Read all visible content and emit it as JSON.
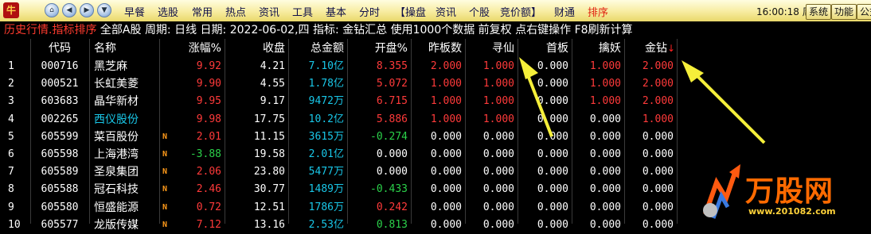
{
  "toolbar": {
    "logo": "牛",
    "menu": [
      "早餐",
      "选股",
      "常用",
      "热点",
      "资讯",
      "工具",
      "基本",
      "分时",
      "【操盘",
      "资讯",
      "个股",
      "竞价额】",
      "财通",
      "排序"
    ],
    "active_index": 13,
    "clock": "16:00:18 周一",
    "buttons": [
      "系统",
      "功能",
      "公式"
    ]
  },
  "info": {
    "title": "历史行情.指标排序",
    "scope": "全部A股",
    "params": "周期: 日线  日期: 2022-06-02,四  指标: 金钻汇总  使用1000个数据 前复权 点右键操作 F8刷新计算"
  },
  "table": {
    "headers": [
      "",
      "代码",
      "名称",
      "",
      "涨幅%",
      "收盘",
      "总金额",
      "开盘%",
      "昨板数",
      "寻仙",
      "首板",
      "擒妖",
      "金钻"
    ],
    "sort_arrow": "↓",
    "rows": [
      {
        "idx": "1",
        "code": "000716",
        "name": "黑芝麻",
        "flag": "",
        "chg": "9.92",
        "close": "4.21",
        "amt": "7.10",
        "unit": "亿",
        "open": "8.355",
        "zb": "2.000",
        "xx": "1.000",
        "sb": "0.000",
        "qy": "1.000",
        "jz": "2.000",
        "name_color": "white",
        "chg_color": "red",
        "amt_color": "cyan",
        "open_color": "red"
      },
      {
        "idx": "2",
        "code": "000521",
        "name": "长虹美菱",
        "flag": "",
        "chg": "9.90",
        "close": "4.55",
        "amt": "1.78",
        "unit": "亿",
        "open": "5.072",
        "zb": "1.000",
        "xx": "1.000",
        "sb": "0.000",
        "qy": "1.000",
        "jz": "2.000",
        "name_color": "white",
        "chg_color": "red",
        "amt_color": "cyan",
        "open_color": "red"
      },
      {
        "idx": "3",
        "code": "603683",
        "name": "晶华新材",
        "flag": "",
        "chg": "9.95",
        "close": "9.17",
        "amt": "9472",
        "unit": "万",
        "open": "6.715",
        "zb": "1.000",
        "xx": "1.000",
        "sb": "0.000",
        "qy": "1.000",
        "jz": "2.000",
        "name_color": "white",
        "chg_color": "red",
        "amt_color": "cyan",
        "open_color": "red"
      },
      {
        "idx": "4",
        "code": "002265",
        "name": "西仪股份",
        "flag": "",
        "chg": "9.98",
        "close": "17.75",
        "amt": "10.2",
        "unit": "亿",
        "open": "5.886",
        "zb": "1.000",
        "xx": "1.000",
        "sb": "0.000",
        "qy": "0.000",
        "jz": "1.000",
        "name_color": "cyan",
        "chg_color": "red",
        "amt_color": "cyan",
        "open_color": "red"
      },
      {
        "idx": "5",
        "code": "605599",
        "name": "菜百股份",
        "flag": "N",
        "chg": "2.01",
        "close": "11.15",
        "amt": "3615",
        "unit": "万",
        "open": "-0.274",
        "zb": "0.000",
        "xx": "0.000",
        "sb": "0.000",
        "qy": "0.000",
        "jz": "0.000",
        "name_color": "white",
        "chg_color": "red",
        "amt_color": "cyan",
        "open_color": "green"
      },
      {
        "idx": "6",
        "code": "605598",
        "name": "上海港湾",
        "flag": "N",
        "chg": "-3.88",
        "close": "19.58",
        "amt": "2.01",
        "unit": "亿",
        "open": "0.000",
        "zb": "0.000",
        "xx": "0.000",
        "sb": "0.000",
        "qy": "0.000",
        "jz": "0.000",
        "name_color": "white",
        "chg_color": "green",
        "amt_color": "cyan",
        "open_color": "white"
      },
      {
        "idx": "7",
        "code": "605589",
        "name": "圣泉集团",
        "flag": "N",
        "chg": "2.06",
        "close": "23.80",
        "amt": "5477",
        "unit": "万",
        "open": "0.000",
        "zb": "0.000",
        "xx": "0.000",
        "sb": "0.000",
        "qy": "0.000",
        "jz": "0.000",
        "name_color": "white",
        "chg_color": "red",
        "amt_color": "cyan",
        "open_color": "white"
      },
      {
        "idx": "8",
        "code": "605588",
        "name": "冠石科技",
        "flag": "N",
        "chg": "2.46",
        "close": "30.77",
        "amt": "1489",
        "unit": "万",
        "open": "-0.433",
        "zb": "0.000",
        "xx": "0.000",
        "sb": "0.000",
        "qy": "0.000",
        "jz": "0.000",
        "name_color": "white",
        "chg_color": "red",
        "amt_color": "cyan",
        "open_color": "green"
      },
      {
        "idx": "9",
        "code": "605580",
        "name": "恒盛能源",
        "flag": "N",
        "chg": "0.72",
        "close": "12.51",
        "amt": "1786",
        "unit": "万",
        "open": "0.242",
        "zb": "0.000",
        "xx": "0.000",
        "sb": "0.000",
        "qy": "0.000",
        "jz": "0.000",
        "name_color": "white",
        "chg_color": "red",
        "amt_color": "cyan",
        "open_color": "red"
      },
      {
        "idx": "10",
        "code": "605577",
        "name": "龙版传媒",
        "flag": "N",
        "chg": "7.12",
        "close": "13.16",
        "amt": "2.53",
        "unit": "亿",
        "open": "0.813",
        "zb": "0.000",
        "xx": "0.000",
        "sb": "0.000",
        "qy": "0.000",
        "jz": "0.000",
        "name_color": "white",
        "chg_color": "red",
        "amt_color": "cyan",
        "open_color": "green"
      }
    ]
  },
  "watermark": {
    "brand": "万股网",
    "url": "www.201082.com"
  },
  "colors": {
    "rise": "#ff3a3a",
    "fall": "#2bd14a",
    "amount": "#19c7e8",
    "annotation_arrow": "#f5ef3a"
  }
}
